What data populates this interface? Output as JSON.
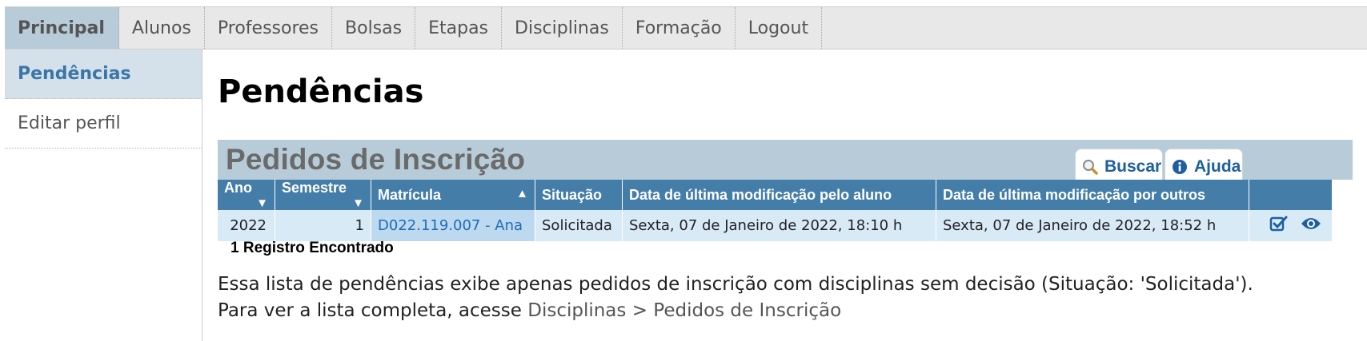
{
  "nav": {
    "tabs": [
      {
        "label": "Principal"
      },
      {
        "label": "Alunos"
      },
      {
        "label": "Professores"
      },
      {
        "label": "Bolsas"
      },
      {
        "label": "Etapas"
      },
      {
        "label": "Disciplinas"
      },
      {
        "label": "Formação"
      },
      {
        "label": "Logout"
      }
    ]
  },
  "sidebar": {
    "items": [
      {
        "label": "Pendências"
      },
      {
        "label": "Editar perfil"
      }
    ]
  },
  "page": {
    "title": "Pendências"
  },
  "panel": {
    "title": "Pedidos de Inscrição",
    "search_label": "Buscar",
    "help_label": "Ajuda",
    "columns": [
      "Ano",
      "Semestre",
      "Matrícula",
      "Situação",
      "Data de última modificação pelo aluno",
      "Data de última modificação por outros"
    ],
    "rows": [
      {
        "ano": "2022",
        "semestre": "1",
        "matricula": "D022.119.007 - Ana",
        "situacao": "Solicitada",
        "mod_aluno": "Sexta, 07 de Janeiro de 2022, 18:10 h",
        "mod_outros": "Sexta, 07 de Janeiro de 2022, 18:52 h"
      }
    ],
    "count_text": "1 Registro Encontrado"
  },
  "note": {
    "line1": "Essa lista de pendências exibe apenas pedidos de inscrição com disciplinas sem decisão (Situação: 'Solicitada').",
    "line2_prefix": "Para ver a lista completa, acesse ",
    "line2_link": "Disciplinas > Pedidos de Inscrição"
  },
  "icons": {
    "search": "magnifier-icon",
    "help": "info-icon",
    "edit": "edit-checkbox-icon",
    "view": "eye-icon"
  },
  "colors": {
    "accent": "#457da9",
    "nav_active": "#b7cbd9",
    "link": "#1e6bb8"
  }
}
